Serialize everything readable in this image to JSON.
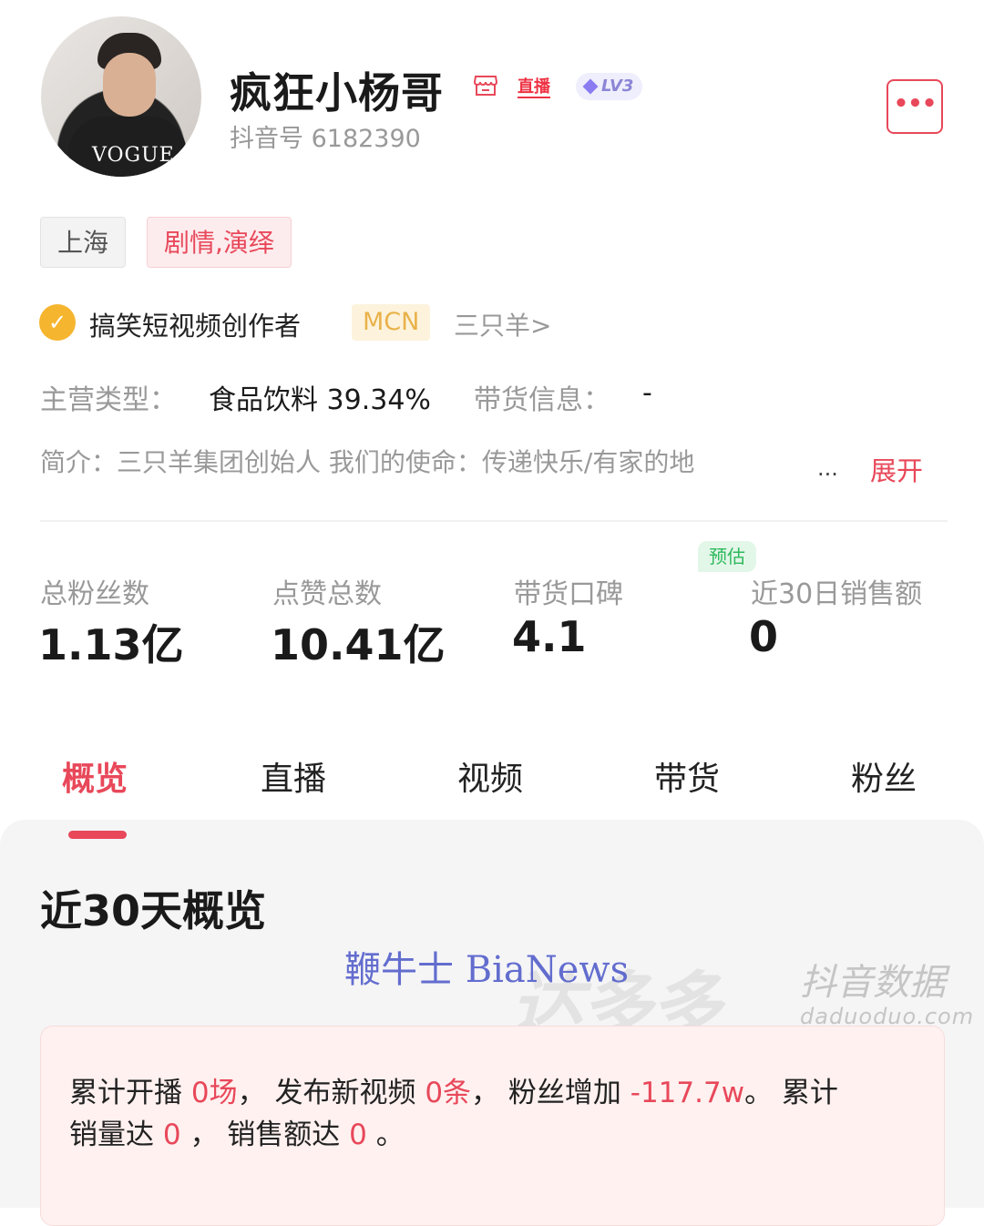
{
  "profile": {
    "name": "疯狂小杨哥",
    "live_tag": "直播",
    "level": "LV3",
    "douyin_id": "抖音号 6182390",
    "avatar_logo": "VOGUE",
    "more_label": "•••"
  },
  "tags": {
    "city": "上海",
    "genre": "剧情,演绎"
  },
  "verification": {
    "text": "搞笑短视频创作者",
    "mcn_label": "MCN",
    "mcn_name": "三只羊>"
  },
  "business": {
    "main_type_label": "主营类型：",
    "main_type_value": "食品饮料 39.34%",
    "goods_label": "带货信息：",
    "goods_value": "-"
  },
  "intro": {
    "text": "简介：三只羊集团创始人 我们的使命：传递快乐/有家的地",
    "ellipsis": "...",
    "expand": "展开"
  },
  "stats": [
    {
      "label": "总粉丝数",
      "value": "1.13亿"
    },
    {
      "label": "点赞总数",
      "value": "10.41亿"
    },
    {
      "label": "带货口碑",
      "value": "4.1"
    },
    {
      "label": "近30日销售额",
      "value": "0",
      "badge": "预估"
    }
  ],
  "tabs": [
    "概览",
    "直播",
    "视频",
    "带货",
    "粉丝"
  ],
  "active_tab": "概览",
  "section_title": "近30天概览",
  "watermarks": {
    "bianews": "鞭牛士 BiaNews",
    "daduoduo": "达多多",
    "douyin_data": "抖音数据",
    "site": "daduoduo.com"
  },
  "summary": {
    "p1": "累计开播 ",
    "live_count": "0场",
    "p2": "， 发布新视频 ",
    "video_count": "0条",
    "p3": "， 粉丝增加 ",
    "fan_change": "-117.7w",
    "p4": "。 累计",
    "p5": "销量达 ",
    "sales_volume": "0",
    "p6": " ， 销售额达 ",
    "sales_amount": "0",
    "p7": " 。"
  },
  "colors": {
    "accent": "#e8485a",
    "mcn": "#e9b24a",
    "estimate": "#2eb85c",
    "level": "#8b86d6"
  }
}
